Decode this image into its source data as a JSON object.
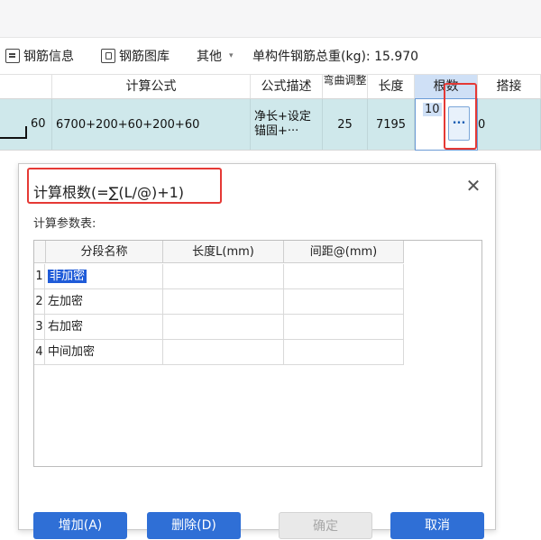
{
  "toolbar": {
    "rebar_info": "钢筋信息",
    "rebar_library": "钢筋图库",
    "other": "其他",
    "total_weight": "单构件钢筋总重(kg): 15.970"
  },
  "grid": {
    "headers": {
      "formula": "计算公式",
      "formula_desc": "公式描述",
      "bend_adjust": "弯曲调整",
      "length": "长度",
      "count": "根数",
      "lap": "搭接"
    },
    "row": {
      "shape_value": "60",
      "formula": "6700+200+60+200+60",
      "desc_line1": "净长+设定",
      "desc_line2": "锚固+···",
      "bend": "25",
      "length": "7195",
      "count": "10",
      "lap": "0",
      "ellipsis": "..."
    }
  },
  "dialog": {
    "title": "计算根数(=∑(L/@)+1)",
    "close_symbol": "✕",
    "param_label": "计算参数表:",
    "table": {
      "headers": [
        "分段名称",
        "长度L(mm)",
        "间距@(mm)"
      ],
      "rows": [
        {
          "num": "1",
          "name": "非加密"
        },
        {
          "num": "2",
          "name": "左加密"
        },
        {
          "num": "3",
          "name": "右加密"
        },
        {
          "num": "4",
          "name": "中间加密"
        }
      ]
    },
    "buttons": {
      "add": "增加(A)",
      "delete": "删除(D)",
      "confirm": "确定",
      "cancel": "取消"
    }
  }
}
